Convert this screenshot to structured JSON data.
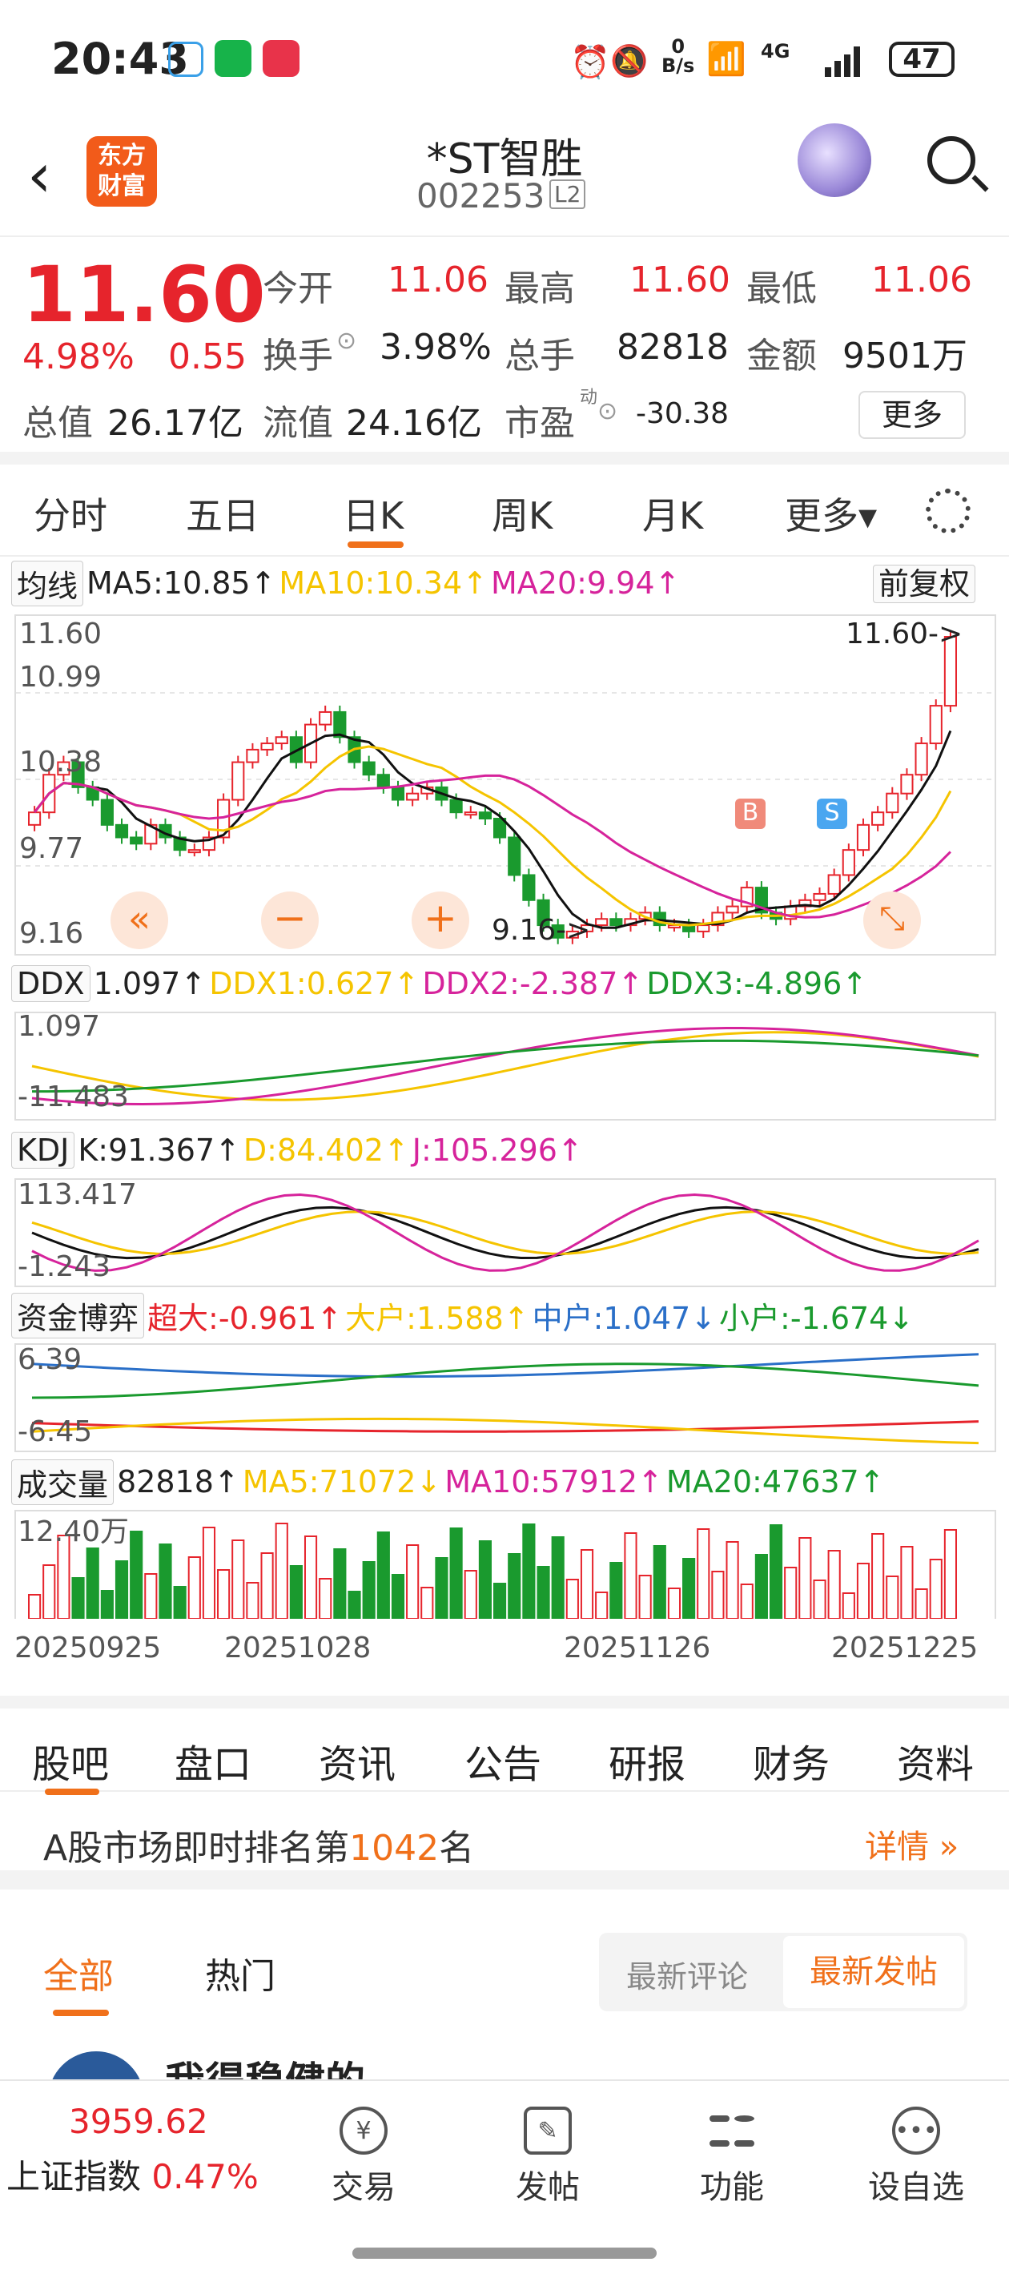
{
  "status": {
    "time": "20:43",
    "net_speed": "0",
    "net_unit": "B/s",
    "network": "4G",
    "battery": "47"
  },
  "header": {
    "logo": "东方\n财富",
    "name": "*ST智胜",
    "code": "002253",
    "level": "L2"
  },
  "quote": {
    "price": "11.60",
    "pct": "4.98%",
    "change": "0.55",
    "open_label": "今开",
    "open": "11.06",
    "high_label": "最高",
    "high": "11.60",
    "low_label": "最低",
    "low": "11.06",
    "turnover_label": "换手",
    "turnover": "3.98%",
    "vol_label": "总手",
    "vol": "82818",
    "amount_label": "金额",
    "amount": "9501万",
    "mcap_label": "总值",
    "mcap": "26.17亿",
    "float_label": "流值",
    "float": "24.16亿",
    "pe_label": "市盈",
    "pe_sup": "动",
    "pe": "-30.38",
    "more": "更多"
  },
  "tabs": [
    "分时",
    "五日",
    "日K",
    "周K",
    "月K",
    "更多▾"
  ],
  "kline": {
    "ma_selector": "均线",
    "ma5": "MA5:10.85↑",
    "ma10": "MA10:10.34↑",
    "ma20": "MA20:9.94↑",
    "adjust": "前复权",
    "y_labels": [
      "11.60",
      "10.99",
      "10.38",
      "9.77",
      "9.16"
    ],
    "max_tag": "11.60->",
    "min_tag": "9.16->",
    "b_mark": "B",
    "s_mark": "S"
  },
  "ddx": {
    "name": "DDX",
    "v": "1.097↑",
    "ddx1": "DDX1:0.627↑",
    "ddx2": "DDX2:-2.387↑",
    "ddx3": "DDX3:-4.896↑",
    "top": "1.097",
    "bottom": "-11.483"
  },
  "kdj": {
    "name": "KDJ",
    "k": "K:91.367↑",
    "d": "D:84.402↑",
    "j": "J:105.296↑",
    "top": "113.417",
    "bottom": "-1.243"
  },
  "fund": {
    "name": "资金博弈",
    "cd": "超大:-0.961↑",
    "dh": "大户:1.588↑",
    "zh": "中户:1.047↓",
    "xh": "小户:-1.674↓",
    "top": "6.39",
    "bottom": "-6.45"
  },
  "volume": {
    "name": "成交量",
    "v": "82818↑",
    "ma5": "MA5:71072↓",
    "ma10": "MA10:57912↑",
    "ma20": "MA20:47637↑",
    "top": "12.40万"
  },
  "dates": [
    "20250925",
    "20251028",
    "20251126",
    "20251225"
  ],
  "chart_data": {
    "type": "candlestick",
    "y_range": [
      9.16,
      11.6
    ],
    "max": 11.6,
    "min": 9.16,
    "last_close": 11.6,
    "ma5": 10.85,
    "ma10": 10.34,
    "ma20": 9.94
  },
  "sections": [
    "股吧",
    "盘口",
    "资讯",
    "公告",
    "研报",
    "财务",
    "资料"
  ],
  "rank": {
    "prefix": "A股市场即时排名第",
    "num": "1042",
    "suffix": "名",
    "detail": "详情 »"
  },
  "posts": {
    "tab_all": "全部",
    "tab_hot": "热门",
    "latest_comment": "最新评论",
    "latest_post": "最新发帖",
    "preview": "我得稳健的"
  },
  "bottom": {
    "index_val": "3959.62",
    "index_name": "上证指数",
    "index_pct": "0.47%",
    "items": [
      "交易",
      "发帖",
      "功能",
      "设自选"
    ]
  },
  "colors": {
    "up": "#e6242c",
    "down": "#1a9a2e",
    "ma10": "#f5c400",
    "ma20": "#d6239b",
    "accent": "#f0701a"
  }
}
